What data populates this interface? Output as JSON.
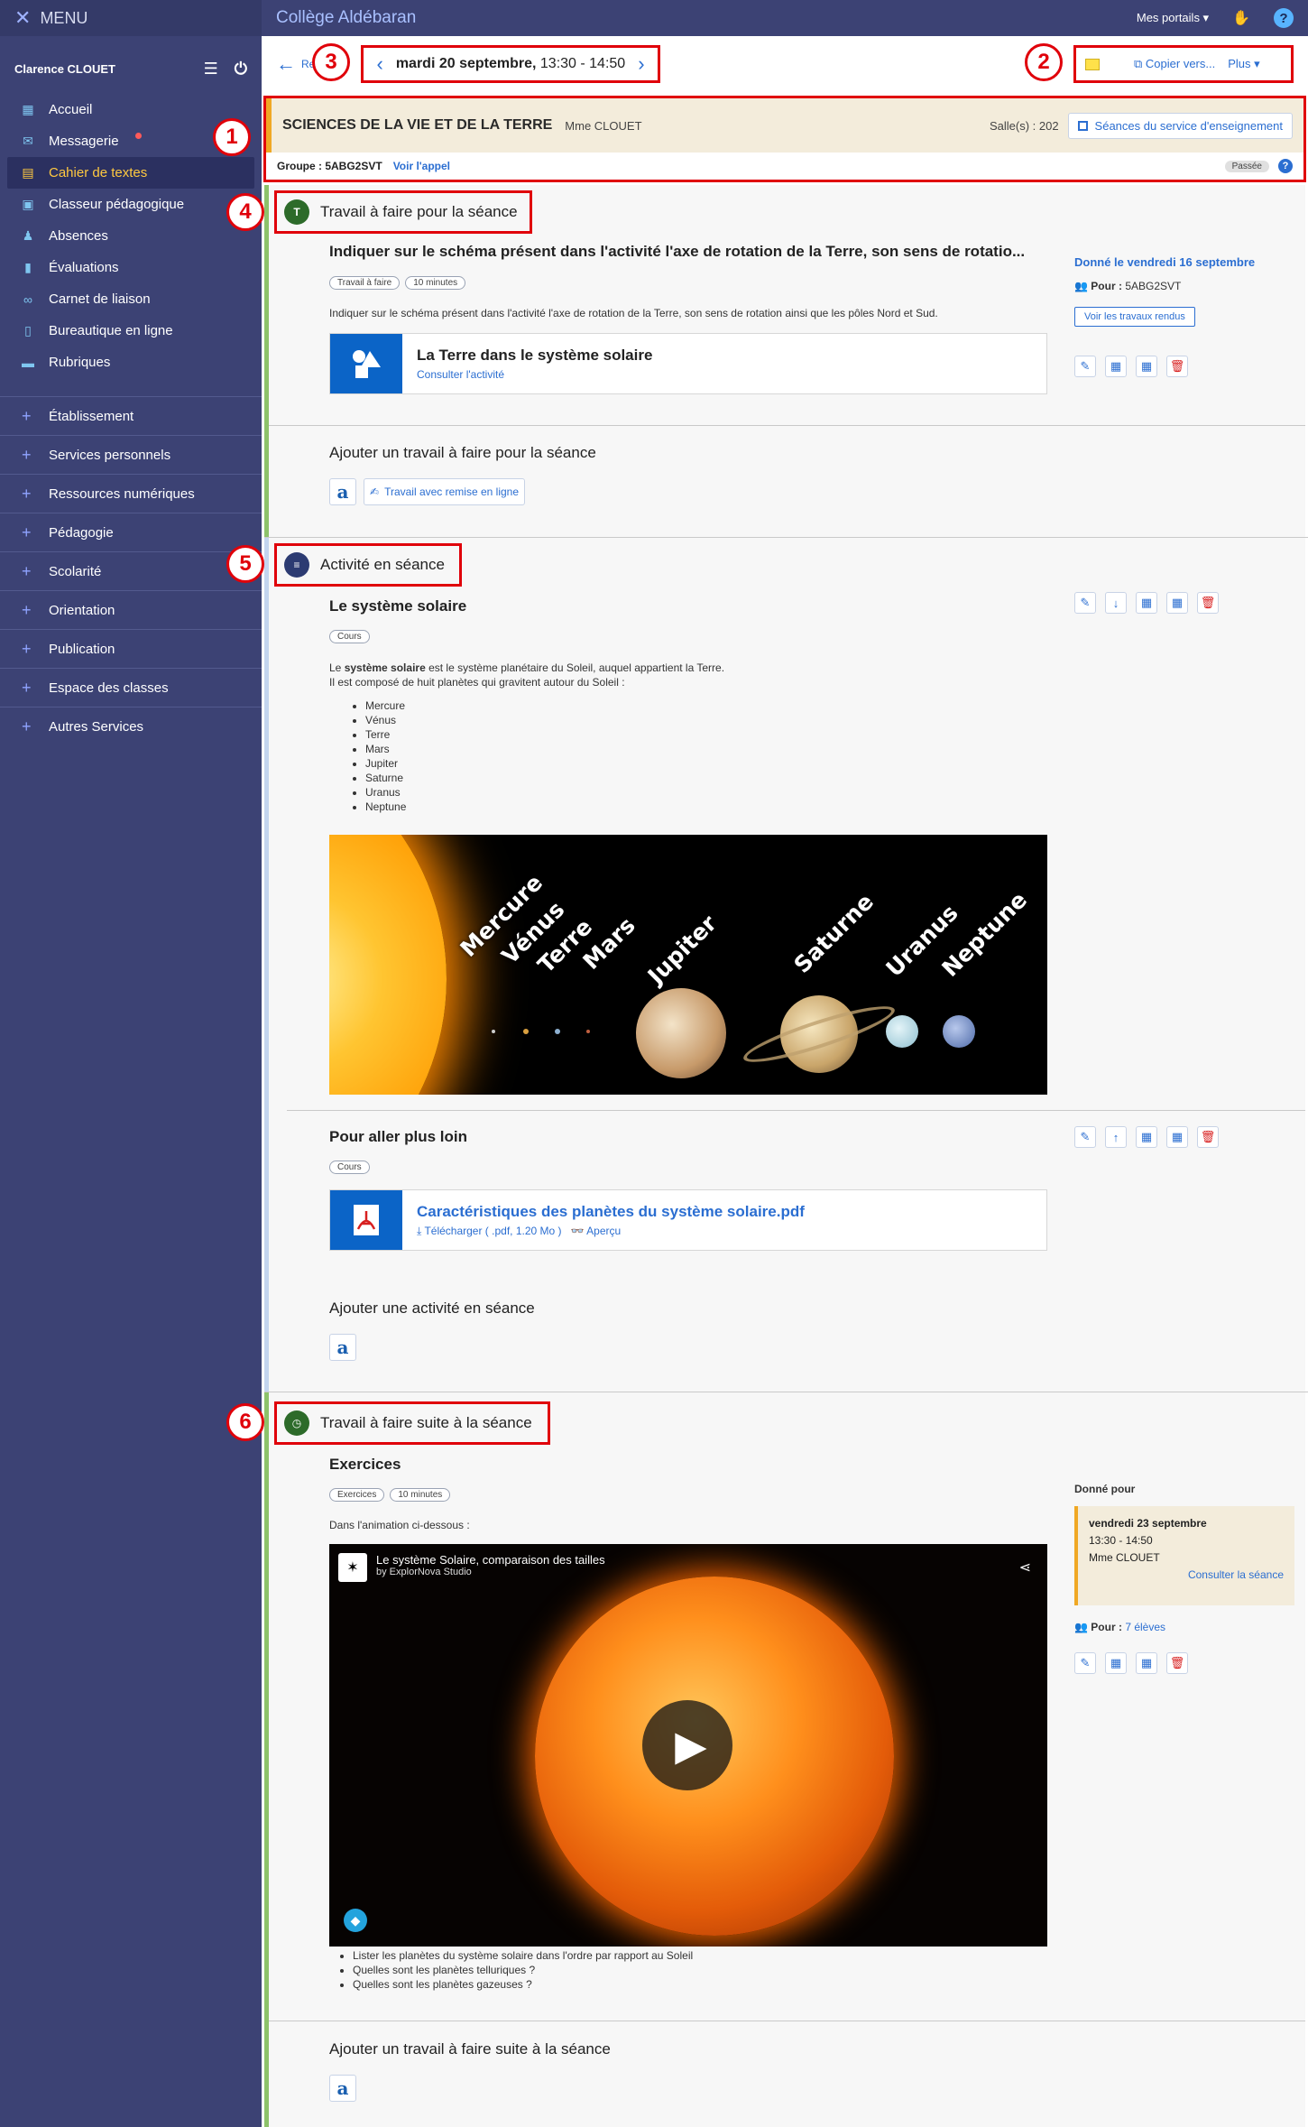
{
  "app": {
    "menu_label": "MENU",
    "school": "Collège Aldébaran",
    "portals": "Mes portails",
    "help": "?"
  },
  "user": {
    "name": "Clarence CLOUET"
  },
  "sidebar": {
    "items": [
      {
        "label": "Accueil",
        "icon": "grid-icon"
      },
      {
        "label": "Messagerie",
        "icon": "mail-icon"
      },
      {
        "label": "Cahier de textes",
        "icon": "book-icon"
      },
      {
        "label": "Classeur pédagogique",
        "icon": "binder-icon"
      },
      {
        "label": "Absences",
        "icon": "user-icon"
      },
      {
        "label": "Évaluations",
        "icon": "bar-chart-icon"
      },
      {
        "label": "Carnet de liaison",
        "icon": "link-icon"
      },
      {
        "label": "Bureautique en ligne",
        "icon": "document-icon"
      },
      {
        "label": "Rubriques",
        "icon": "chat-icon"
      }
    ],
    "sections": [
      "Établissement",
      "Services personnels",
      "Ressources numériques",
      "Pédagogie",
      "Scolarité",
      "Orientation",
      "Publication",
      "Espace des classes",
      "Autres Services"
    ]
  },
  "toolbar": {
    "back_label": "Re",
    "date_bold": "mardi 20 septembre,",
    "time": "13:30 - 14:50",
    "copy_label": "Copier vers...",
    "more_label": "Plus"
  },
  "course": {
    "title": "SCIENCES DE LA VIE ET DE LA TERRE",
    "teacher": "Mme CLOUET",
    "room": "Salle(s) : 202",
    "sessions_btn": "Séances du service d'enseignement",
    "group": "Groupe : 5ABG2SVT",
    "roll_call": "Voir l'appel",
    "status": "Passée"
  },
  "callouts": [
    "1",
    "2",
    "3",
    "4",
    "5",
    "6"
  ],
  "homework_before": {
    "title": "Travail à faire pour la séance",
    "badge": "T",
    "item_title": "Indiquer sur le schéma présent dans l'activité l'axe de rotation de la Terre, son sens de rotatio...",
    "pills": [
      "Travail à faire",
      "10 minutes"
    ],
    "text": "Indiquer sur le schéma présent dans l'activité l'axe de rotation de la Terre, son sens de rotation ainsi que les pôles Nord et Sud.",
    "resource_title": "La Terre dans le système solaire",
    "resource_link": "Consulter l'activité",
    "given": "Donné le vendredi 16 septembre",
    "for_label": "Pour :",
    "for_value": "5ABG2SVT",
    "view_btn": "Voir les travaux rendus",
    "add_title": "Ajouter un travail à faire pour la séance",
    "add_online": "Travail avec remise en ligne"
  },
  "activity": {
    "title": "Activité en séance",
    "item1_title": "Le système solaire",
    "item1_pill": "Cours",
    "item1_text_pre": "Le ",
    "item1_text_bold": "système solaire",
    "item1_text_post": " est le système planétaire du Soleil, auquel appartient la Terre.",
    "item1_text2": "Il est composé de huit planètes qui gravitent autour du Soleil :",
    "planets": [
      "Mercure",
      "Vénus",
      "Terre",
      "Mars",
      "Jupiter",
      "Saturne",
      "Uranus",
      "Neptune"
    ],
    "item2_title": "Pour aller plus loin",
    "item2_pill": "Cours",
    "file_title": "Caractéristiques des planètes du système solaire.pdf",
    "download": "Télécharger ( .pdf, 1.20 Mo )",
    "preview": "Aperçu",
    "add_title": "Ajouter une activité en séance"
  },
  "homework_after": {
    "title": "Travail à faire suite à la séance",
    "item_title": "Exercices",
    "pills": [
      "Exercices",
      "10 minutes"
    ],
    "intro": "Dans l'animation ci-dessous :",
    "video_title": "Le système Solaire, comparaison des tailles",
    "video_author": "by ExplorNova Studio",
    "questions": [
      "Lister les planètes du système solaire dans l'ordre par rapport au Soleil",
      "Quelles sont les planètes telluriques ?",
      "Quelles sont les planètes gazeuses ?"
    ],
    "given_for": "Donné pour",
    "due_date": "vendredi 23 septembre",
    "due_time": "13:30 - 14:50",
    "due_teacher": "Mme CLOUET",
    "due_link": "Consulter la séance",
    "for_label": "Pour :",
    "for_value": "7 élèves",
    "add_title": "Ajouter un travail à faire suite à la séance"
  }
}
